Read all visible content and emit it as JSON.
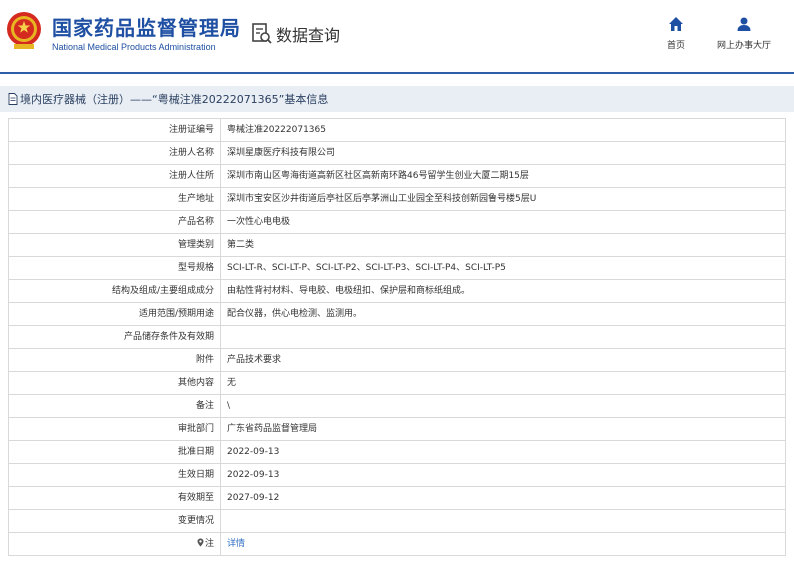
{
  "header": {
    "org_name_cn": "国家药品监督管理局",
    "org_name_en": "National Medical Products Administration",
    "query_label": "数据查询",
    "nav": [
      {
        "label": "首页",
        "icon": "home-icon"
      },
      {
        "label": "网上办事大厅",
        "icon": "user-icon"
      }
    ]
  },
  "titlebar": {
    "text": "境内医疗器械（注册）——“粤械注准20222071365”基本信息"
  },
  "rows": [
    {
      "label": "注册证编号",
      "value": "粤械注准20222071365"
    },
    {
      "label": "注册人名称",
      "value": "深圳星康医疗科技有限公司"
    },
    {
      "label": "注册人住所",
      "value": "深圳市南山区粤海街道高新区社区高新南环路46号留学生创业大厦二期15层"
    },
    {
      "label": "生产地址",
      "value": "深圳市宝安区沙井街道后亭社区后亭茅洲山工业园全至科技创新园鲁号楼5层U"
    },
    {
      "label": "产品名称",
      "value": "一次性心电电极"
    },
    {
      "label": "管理类别",
      "value": "第二类"
    },
    {
      "label": "型号规格",
      "value": "SCI-LT-R、SCI-LT-P、SCI-LT-P2、SCI-LT-P3、SCI-LT-P4、SCI-LT-P5"
    },
    {
      "label": "结构及组成/主要组成成分",
      "value": "由粘性背衬材料、导电胶、电极纽扣、保护层和商标纸组成。"
    },
    {
      "label": "适用范围/预期用途",
      "value": "配合仪器，供心电检测、监测用。"
    },
    {
      "label": "产品储存条件及有效期",
      "value": ""
    },
    {
      "label": "附件",
      "value": "产品技术要求"
    },
    {
      "label": "其他内容",
      "value": "无"
    },
    {
      "label": "备注",
      "value": "\\"
    },
    {
      "label": "审批部门",
      "value": "广东省药品监督管理局"
    },
    {
      "label": "批准日期",
      "value": "2022-09-13"
    },
    {
      "label": "生效日期",
      "value": "2022-09-13"
    },
    {
      "label": "有效期至",
      "value": "2027-09-12"
    },
    {
      "label": "变更情况",
      "value": ""
    }
  ],
  "note_row": {
    "label": "注",
    "link": "详情",
    "icon": "pin-icon"
  },
  "colors": {
    "brand_blue": "#1e4fa3",
    "link_blue": "#2f6fc4",
    "titlebar_bg": "#e9eef4",
    "border": "#d9d9d9"
  }
}
